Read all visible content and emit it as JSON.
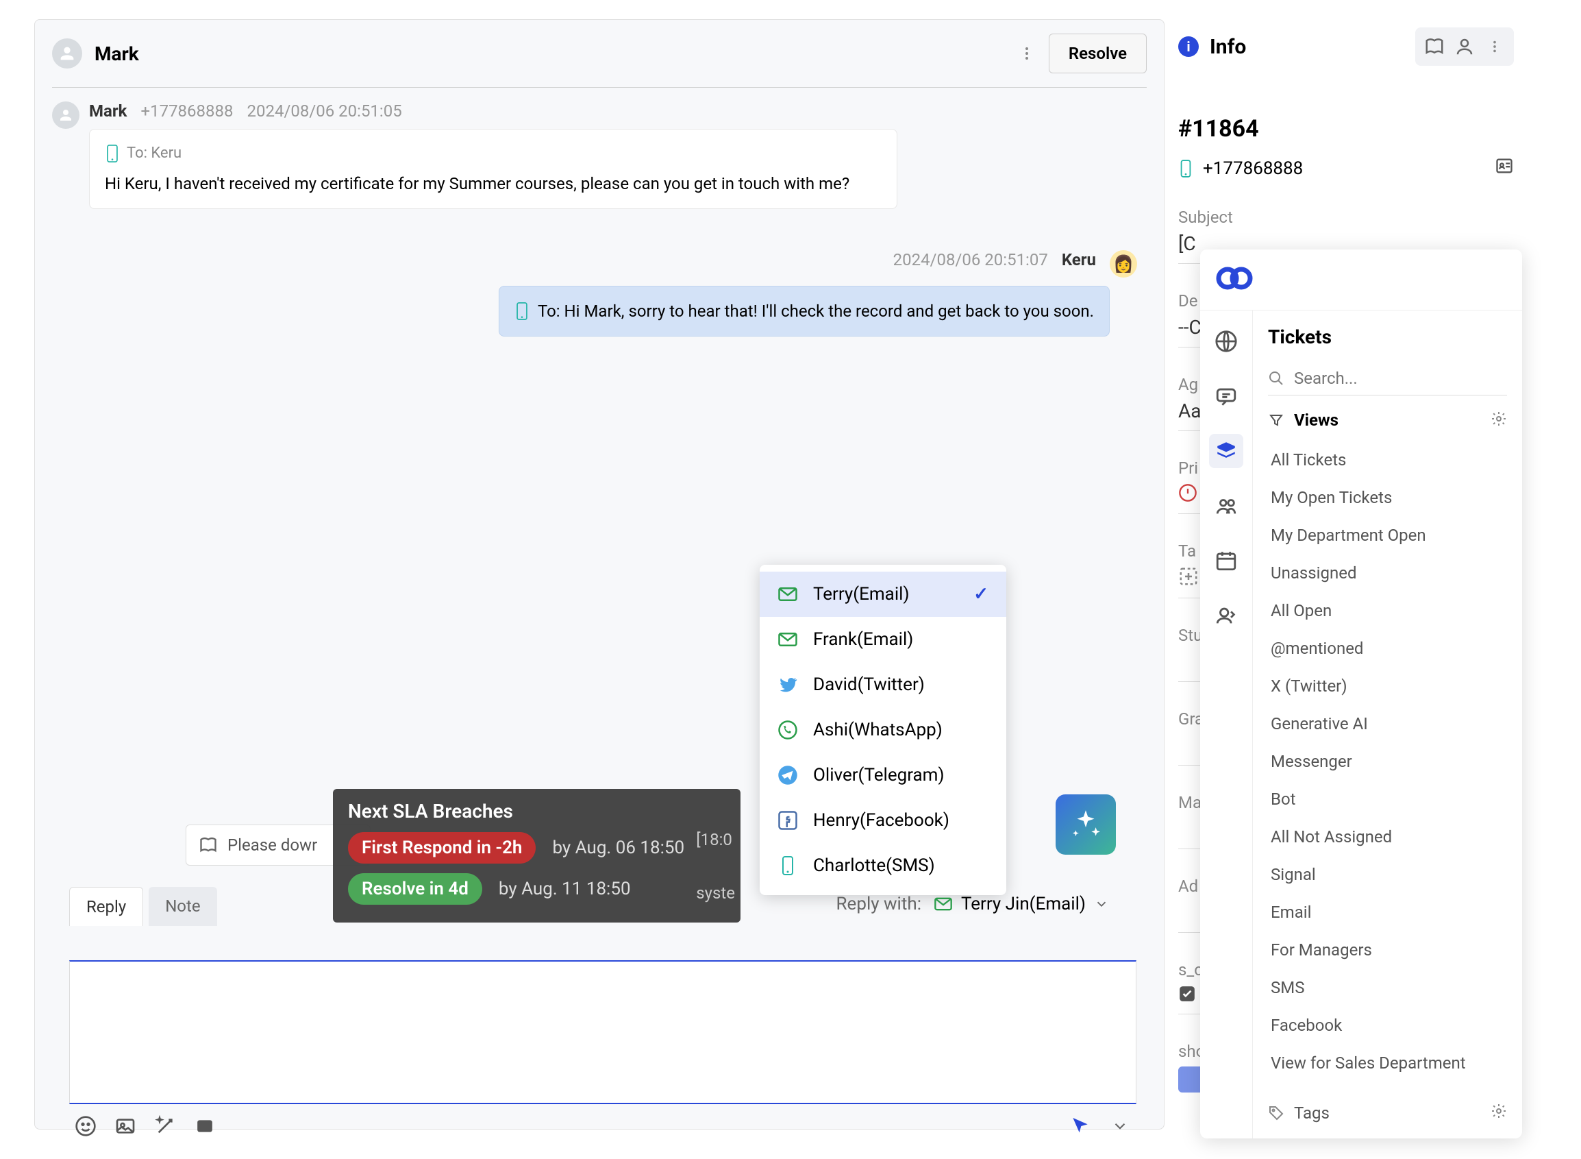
{
  "header": {
    "name": "Mark",
    "resolve_label": "Resolve"
  },
  "messages": {
    "incoming": {
      "sender": "Mark",
      "phone": "+177868888",
      "timestamp": "2024/08/06 20:51:05",
      "to_label": "To: Keru",
      "body": "Hi Keru, I haven't received my certificate for my Summer courses, please can you get in touch with me?"
    },
    "outgoing": {
      "timestamp": "2024/08/06 20:51:07",
      "sender": "Keru",
      "body": "To: Hi Mark, sorry to hear that! I'll check the record and get back to you soon."
    }
  },
  "sla": {
    "title": "Next SLA Breaches",
    "row1_pill": "First Respond in -2h",
    "row1_by": "by Aug. 06 18:50",
    "row2_pill": "Resolve in 4d",
    "row2_by": "by Aug. 11 18:50",
    "side1": "[18:0",
    "side2": "syste"
  },
  "please_bar": "Please dowr",
  "reply_options": [
    {
      "label": "Terry(Email)",
      "channel": "email",
      "selected": true
    },
    {
      "label": "Frank(Email)",
      "channel": "email"
    },
    {
      "label": "David(Twitter)",
      "channel": "twitter"
    },
    {
      "label": "Ashi(WhatsApp)",
      "channel": "whatsapp"
    },
    {
      "label": "Oliver(Telegram)",
      "channel": "telegram"
    },
    {
      "label": "Henry(Facebook)",
      "channel": "facebook"
    },
    {
      "label": "Charlotte(SMS)",
      "channel": "sms"
    }
  ],
  "compose": {
    "tab_reply": "Reply",
    "tab_note": "Note",
    "reply_with_label": "Reply with:",
    "reply_with_value": "Terry Jin(Email)"
  },
  "info": {
    "title": "Info",
    "ticket_number": "#11864",
    "phone": "+177868888",
    "labels": {
      "subject": "Subject",
      "de": "De",
      "ag": "Ag",
      "pri": "Pri",
      "tag": "Ta",
      "stu": "Stu",
      "gra": "Gra",
      "ma": "Ma",
      "ad": "Ad",
      "sc": "s_c",
      "sho": "sho"
    },
    "values": {
      "subject": "[C",
      "de": "--C",
      "ag": "Aa"
    }
  },
  "tickets": {
    "title": "Tickets",
    "search_placeholder": "Search...",
    "views_label": "Views",
    "views": [
      "All Tickets",
      "My Open Tickets",
      "My Department Open",
      "Unassigned",
      "All Open",
      "@mentioned",
      "X (Twitter)",
      "Generative AI",
      "Messenger",
      "Bot",
      "All Not Assigned",
      "Signal",
      "Email",
      "For Managers",
      "SMS",
      "Facebook",
      "View for Sales Department"
    ],
    "tags_label": "Tags"
  }
}
